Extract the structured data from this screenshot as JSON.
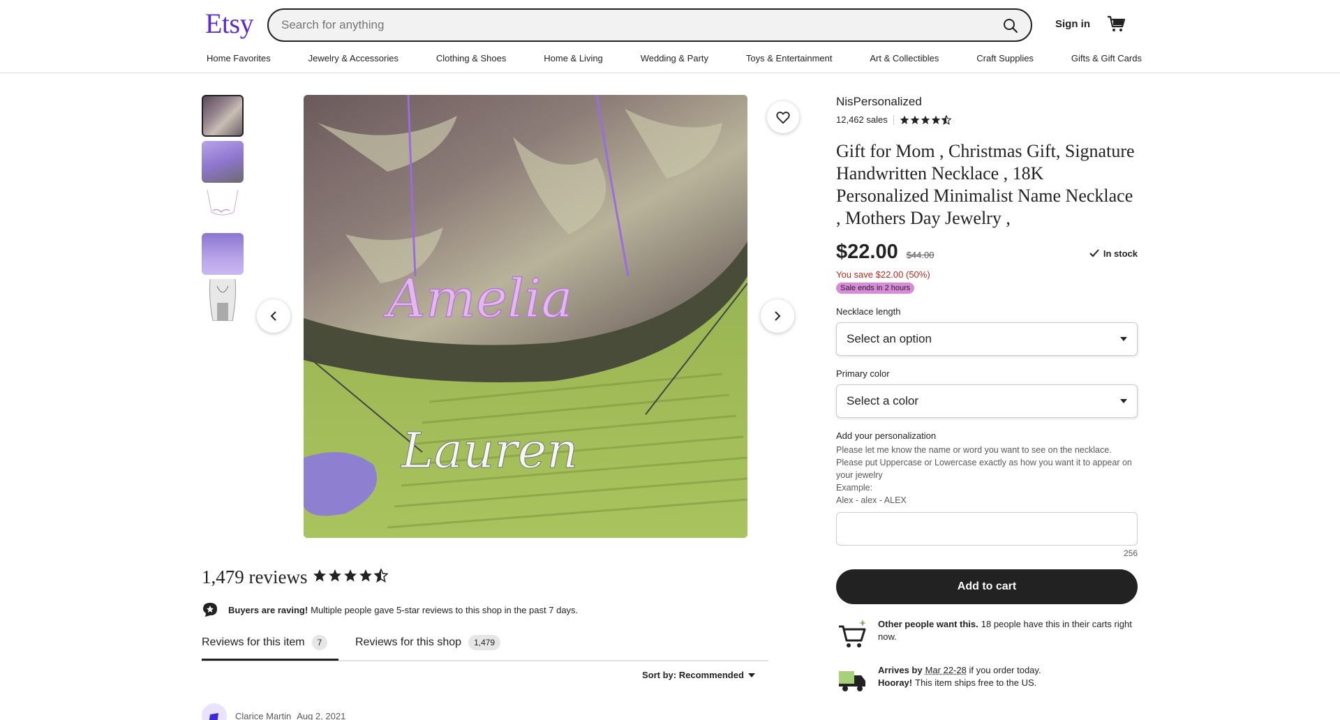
{
  "header": {
    "logo": "Etsy",
    "search_placeholder": "Search for anything",
    "signin": "Sign in",
    "nav": [
      "Home Favorites",
      "Jewelry & Accessories",
      "Clothing & Shoes",
      "Home & Living",
      "Wedding & Party",
      "Toys & Entertainment",
      "Art & Collectibles",
      "Craft Supplies",
      "Gifts & Gift Cards"
    ]
  },
  "product": {
    "shop_name": "NisPersonalized",
    "sales": "12,462 sales",
    "rating": 4.5,
    "title": "Gift for Mom , Christmas Gift, Signature Handwritten Necklace , 18K Personalized Minimalist Name Necklace , Mothers Day Jewelry ,",
    "price": "$22.00",
    "old_price": "$44.00",
    "stock": "In stock",
    "savings": "You save $22.00 (50%)",
    "sale_badge": "Sale ends in 2 hours",
    "option1_label": "Necklace length",
    "option1_value": "Select an option",
    "option2_label": "Primary color",
    "option2_value": "Select a color",
    "personalization_label": "Add your personalization",
    "personalization_help": [
      "Please let me know the name or word you want to see on the necklace.",
      "Please put Uppercase or Lowercase exactly as how you want it to appear on your jewelry",
      "Example:",
      "Alex - alex - ALEX"
    ],
    "char_count": "256",
    "add_to_cart": "Add to cart",
    "cart_info_bold": "Other people want this.",
    "cart_info": "18 people have this in their carts right now.",
    "arrives_bold": "Arrives by",
    "arrives_date": "Mar 22-28",
    "arrives_rest": "if you order today.",
    "hooray_bold": "Hooray!",
    "hooray_rest": "This item ships free to the US."
  },
  "reviews": {
    "title": "1,479 reviews",
    "raving_bold": "Buyers are raving!",
    "raving_text": "Multiple people gave 5-star reviews to this shop in the past 7 days.",
    "tab_item": "Reviews for this item",
    "tab_item_count": "7",
    "tab_shop": "Reviews for this shop",
    "tab_shop_count": "1,479",
    "sort": "Sort by: Recommended",
    "reviewer_name": "Clarice Martin",
    "review_date": "Aug 2, 2021"
  },
  "image_text": {
    "name_top": "Amelia",
    "name_bottom": "Lauren"
  },
  "colors": {
    "brand": "#F1641E",
    "logo": "#5D2CC4",
    "sale": "#B32D1E",
    "badge": "#D98AD9"
  }
}
